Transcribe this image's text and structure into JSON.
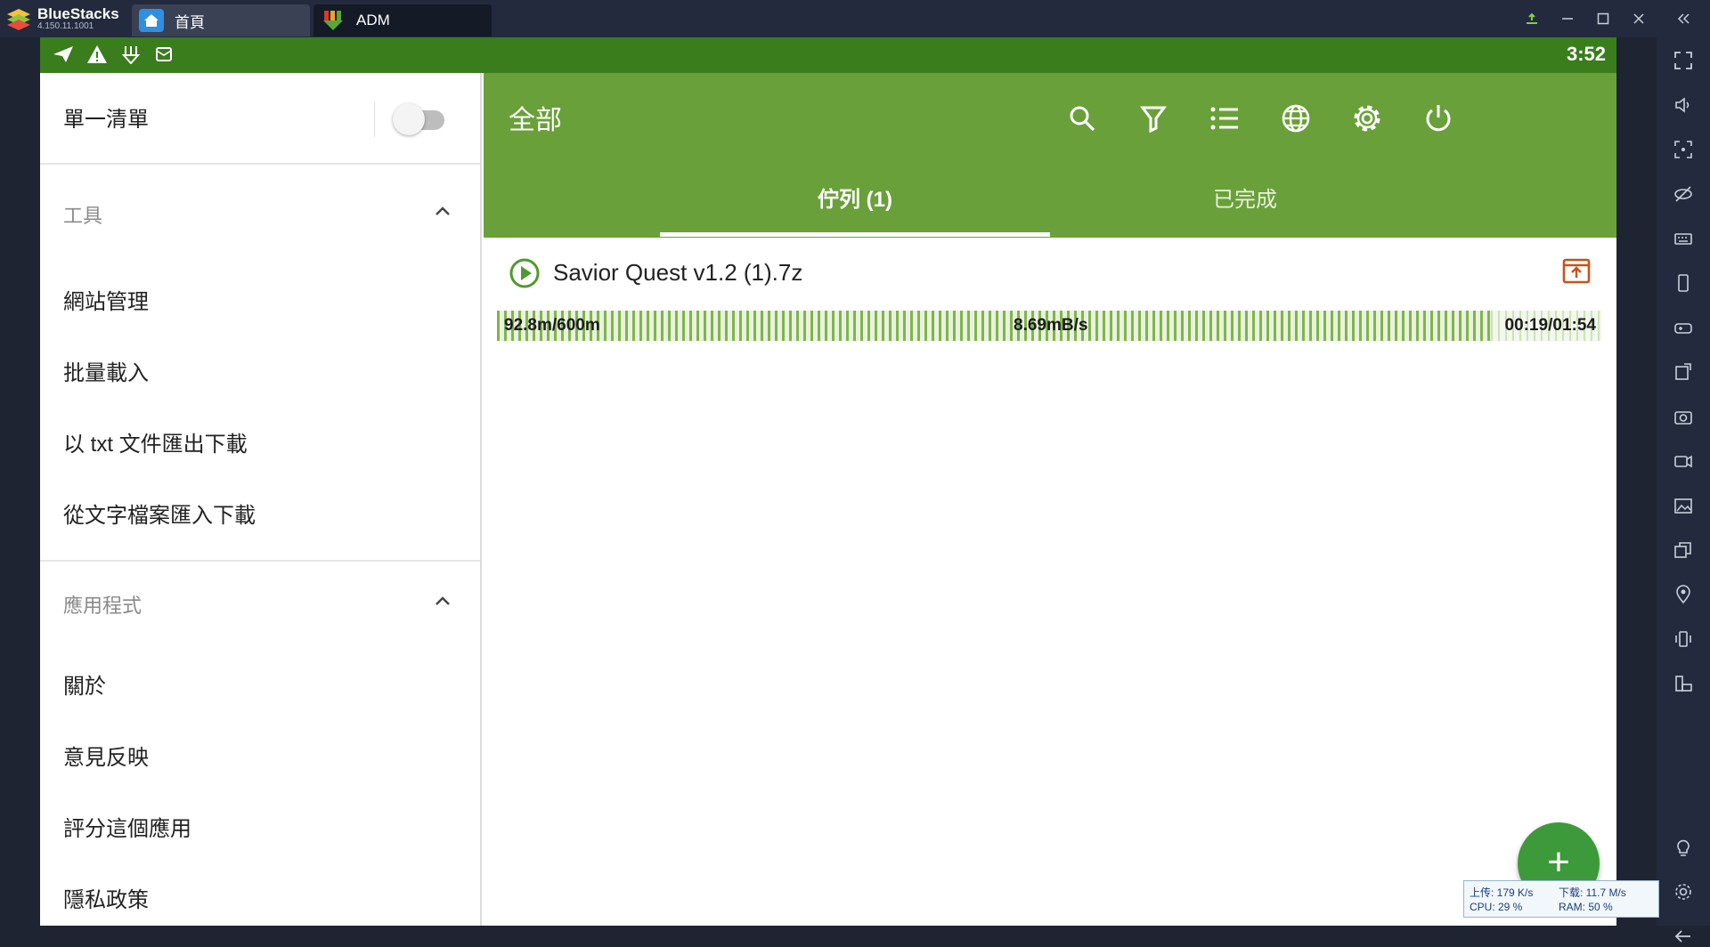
{
  "titlebar": {
    "app_name": "BlueStacks",
    "version": "4.150.11.1001",
    "tabs": [
      {
        "label": "首頁"
      },
      {
        "label": "ADM"
      }
    ]
  },
  "statusbar": {
    "time": "3:52"
  },
  "drawer": {
    "single_list_label": "單一清單",
    "single_list_on": false,
    "sections": [
      {
        "title": "工具",
        "items": [
          "網站管理",
          "批量載入",
          "以 txt 文件匯出下載",
          "從文字檔案匯入下載"
        ]
      },
      {
        "title": "應用程式",
        "items": [
          "關於",
          "意見反映",
          "評分這個應用",
          "隱私政策"
        ]
      }
    ]
  },
  "appbar": {
    "title": "全部",
    "icons": [
      "search-icon",
      "filter-icon",
      "list-icon",
      "globe-icon",
      "gear-icon",
      "power-icon"
    ],
    "tabs": [
      {
        "label": "佇列 (1)",
        "active": true
      },
      {
        "label": "已完成",
        "active": false
      }
    ]
  },
  "download": {
    "name": "Savior Quest v1.2 (1).7z",
    "size_progress": "92.8m/600m",
    "speed": "8.69mB/s",
    "time": "00:19/01:54",
    "progress_fraction": 0.155
  },
  "fab": {
    "label": "+"
  },
  "netwidget": {
    "upload": "上传: 179 K/s",
    "download": "下载: 11.7 M/s",
    "cpu": "CPU: 29 %",
    "ram": "RAM: 50 %"
  },
  "colors": {
    "statusbar": "#3a7d1c",
    "appbar": "#6aa03a",
    "accent": "#3d9a3a"
  }
}
